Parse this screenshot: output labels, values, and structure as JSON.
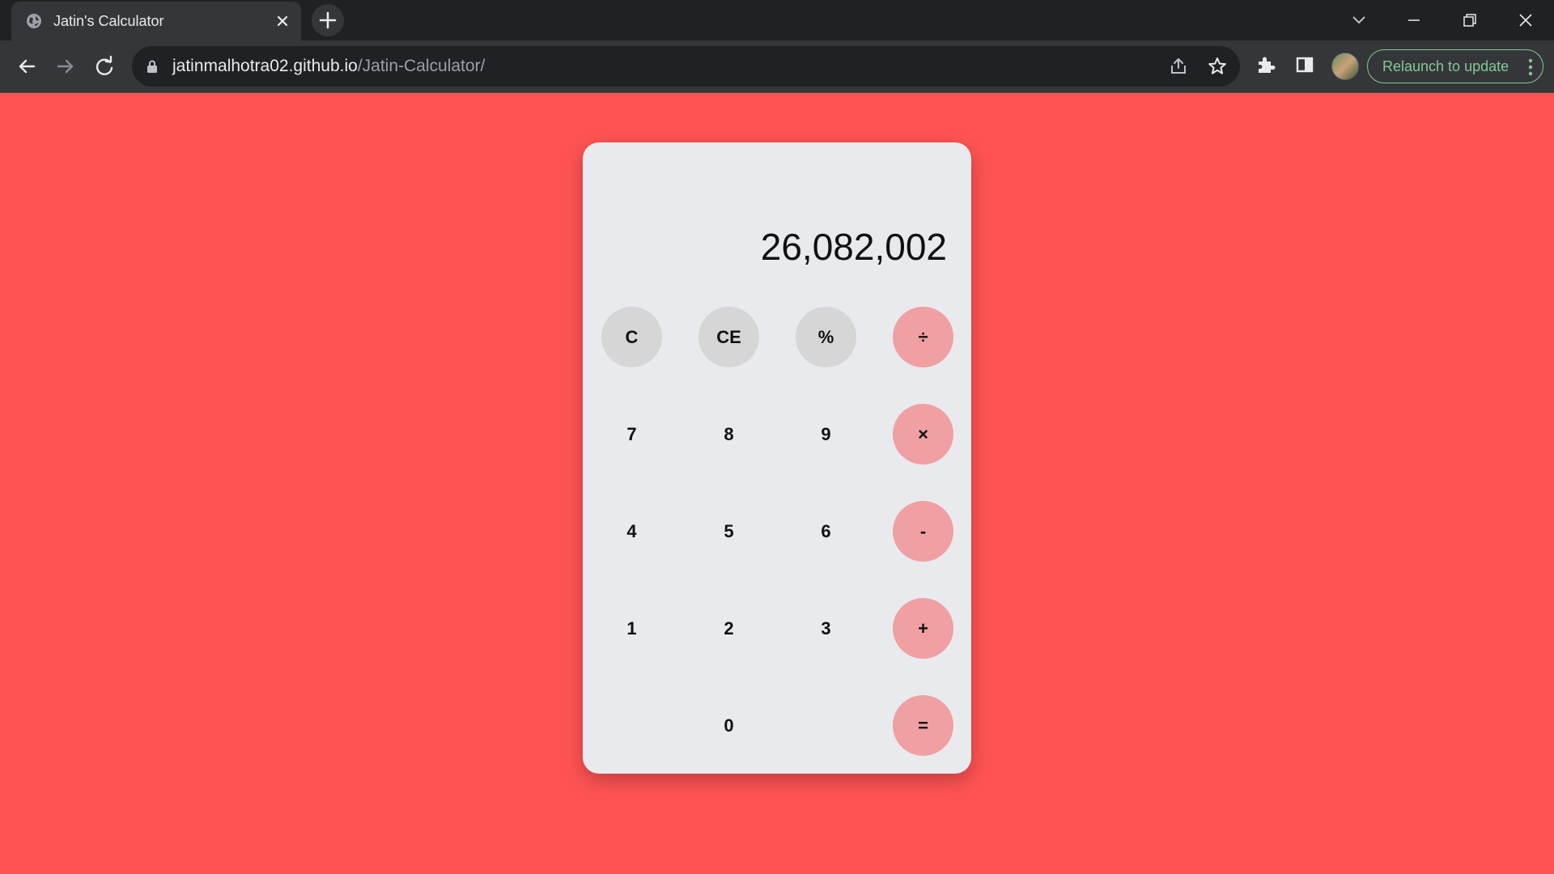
{
  "browser": {
    "tab": {
      "title": "Jatin's Calculator",
      "favicon": "globe-icon"
    },
    "address_bar": {
      "host": "jatinmalhotra02.github.io",
      "path": "/Jatin-Calculator/"
    },
    "relaunch_label": "Relaunch to update",
    "colors": {
      "frame": "#202124",
      "toolbar": "#35363a",
      "relaunch": "#81c995"
    }
  },
  "calculator": {
    "display": "26,082,002",
    "keys": {
      "clear": "C",
      "clear_entry": "CE",
      "percent": "%",
      "divide": "÷",
      "seven": "7",
      "eight": "8",
      "nine": "9",
      "multiply": "×",
      "four": "4",
      "five": "5",
      "six": "6",
      "subtract": "-",
      "one": "1",
      "two": "2",
      "three": "3",
      "add": "+",
      "zero": "0",
      "equals": "="
    },
    "colors": {
      "background": "#ff5353",
      "panel": "#e8eaed",
      "function_key": "#d6d6d6",
      "operator_key": "#f0a0a3"
    }
  }
}
